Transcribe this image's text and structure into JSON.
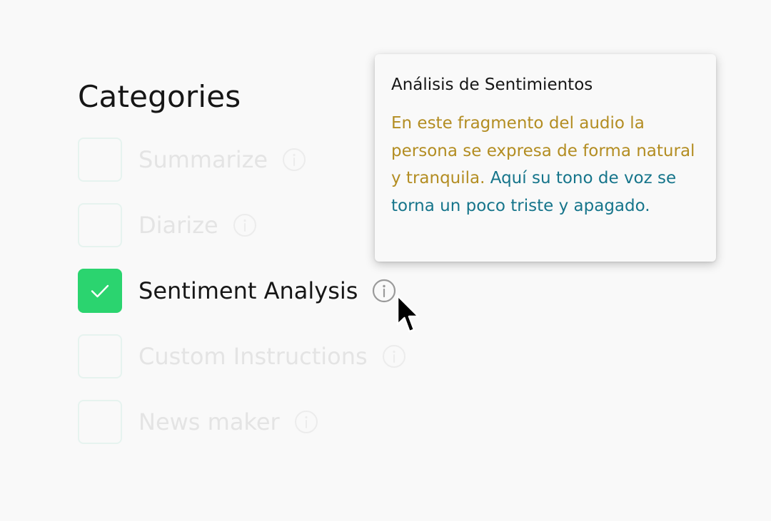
{
  "page": {
    "title": "Categories"
  },
  "categories": [
    {
      "label": "Summarize",
      "checked": false
    },
    {
      "label": "Diarize",
      "checked": false
    },
    {
      "label": "Sentiment Analysis",
      "checked": true
    },
    {
      "label": "Custom Instructions",
      "checked": false
    },
    {
      "label": "News maker",
      "checked": false
    }
  ],
  "tooltip": {
    "title": "Análisis de Sentimientos",
    "body_part_1": "En este fragmento del audio la persona se expresa de forma natural y tranquila.",
    "body_part_2": "Aquí su tono de voz se torna un poco triste y apagado."
  },
  "icons": {
    "info": "info-icon",
    "check": "check-icon",
    "cursor": "cursor-arrow-icon"
  },
  "colors": {
    "accent_green": "#2bd46f",
    "tooltip_text_warm": "#b38d22",
    "tooltip_text_cool": "#16758b",
    "disabled_text": "#e4e4e4",
    "primary_text": "#161616"
  }
}
